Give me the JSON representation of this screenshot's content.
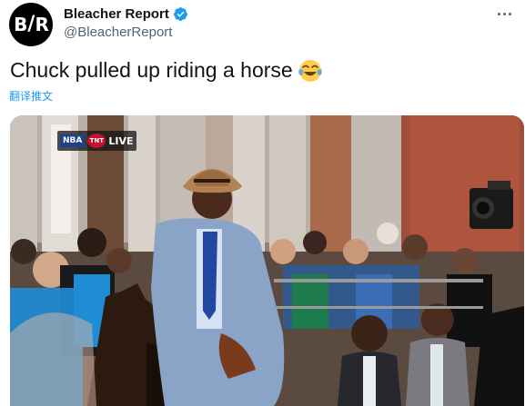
{
  "tweet": {
    "author": {
      "display_name": "Bleacher Report",
      "handle": "@BleacherReport",
      "avatar_text": "B/R",
      "verified": true
    },
    "text": "Chuck pulled up riding a horse",
    "emoji": "face-with-tears-of-joy",
    "translate_label": "翻译推文",
    "media": {
      "tv_bug": {
        "network_logo": "NBA",
        "channel_logo": "TNT",
        "status": "LIVE"
      }
    }
  },
  "colors": {
    "text_primary": "#0f1419",
    "text_secondary": "#536471",
    "link": "#1d9bf0",
    "verified": "#1d9bf0"
  }
}
